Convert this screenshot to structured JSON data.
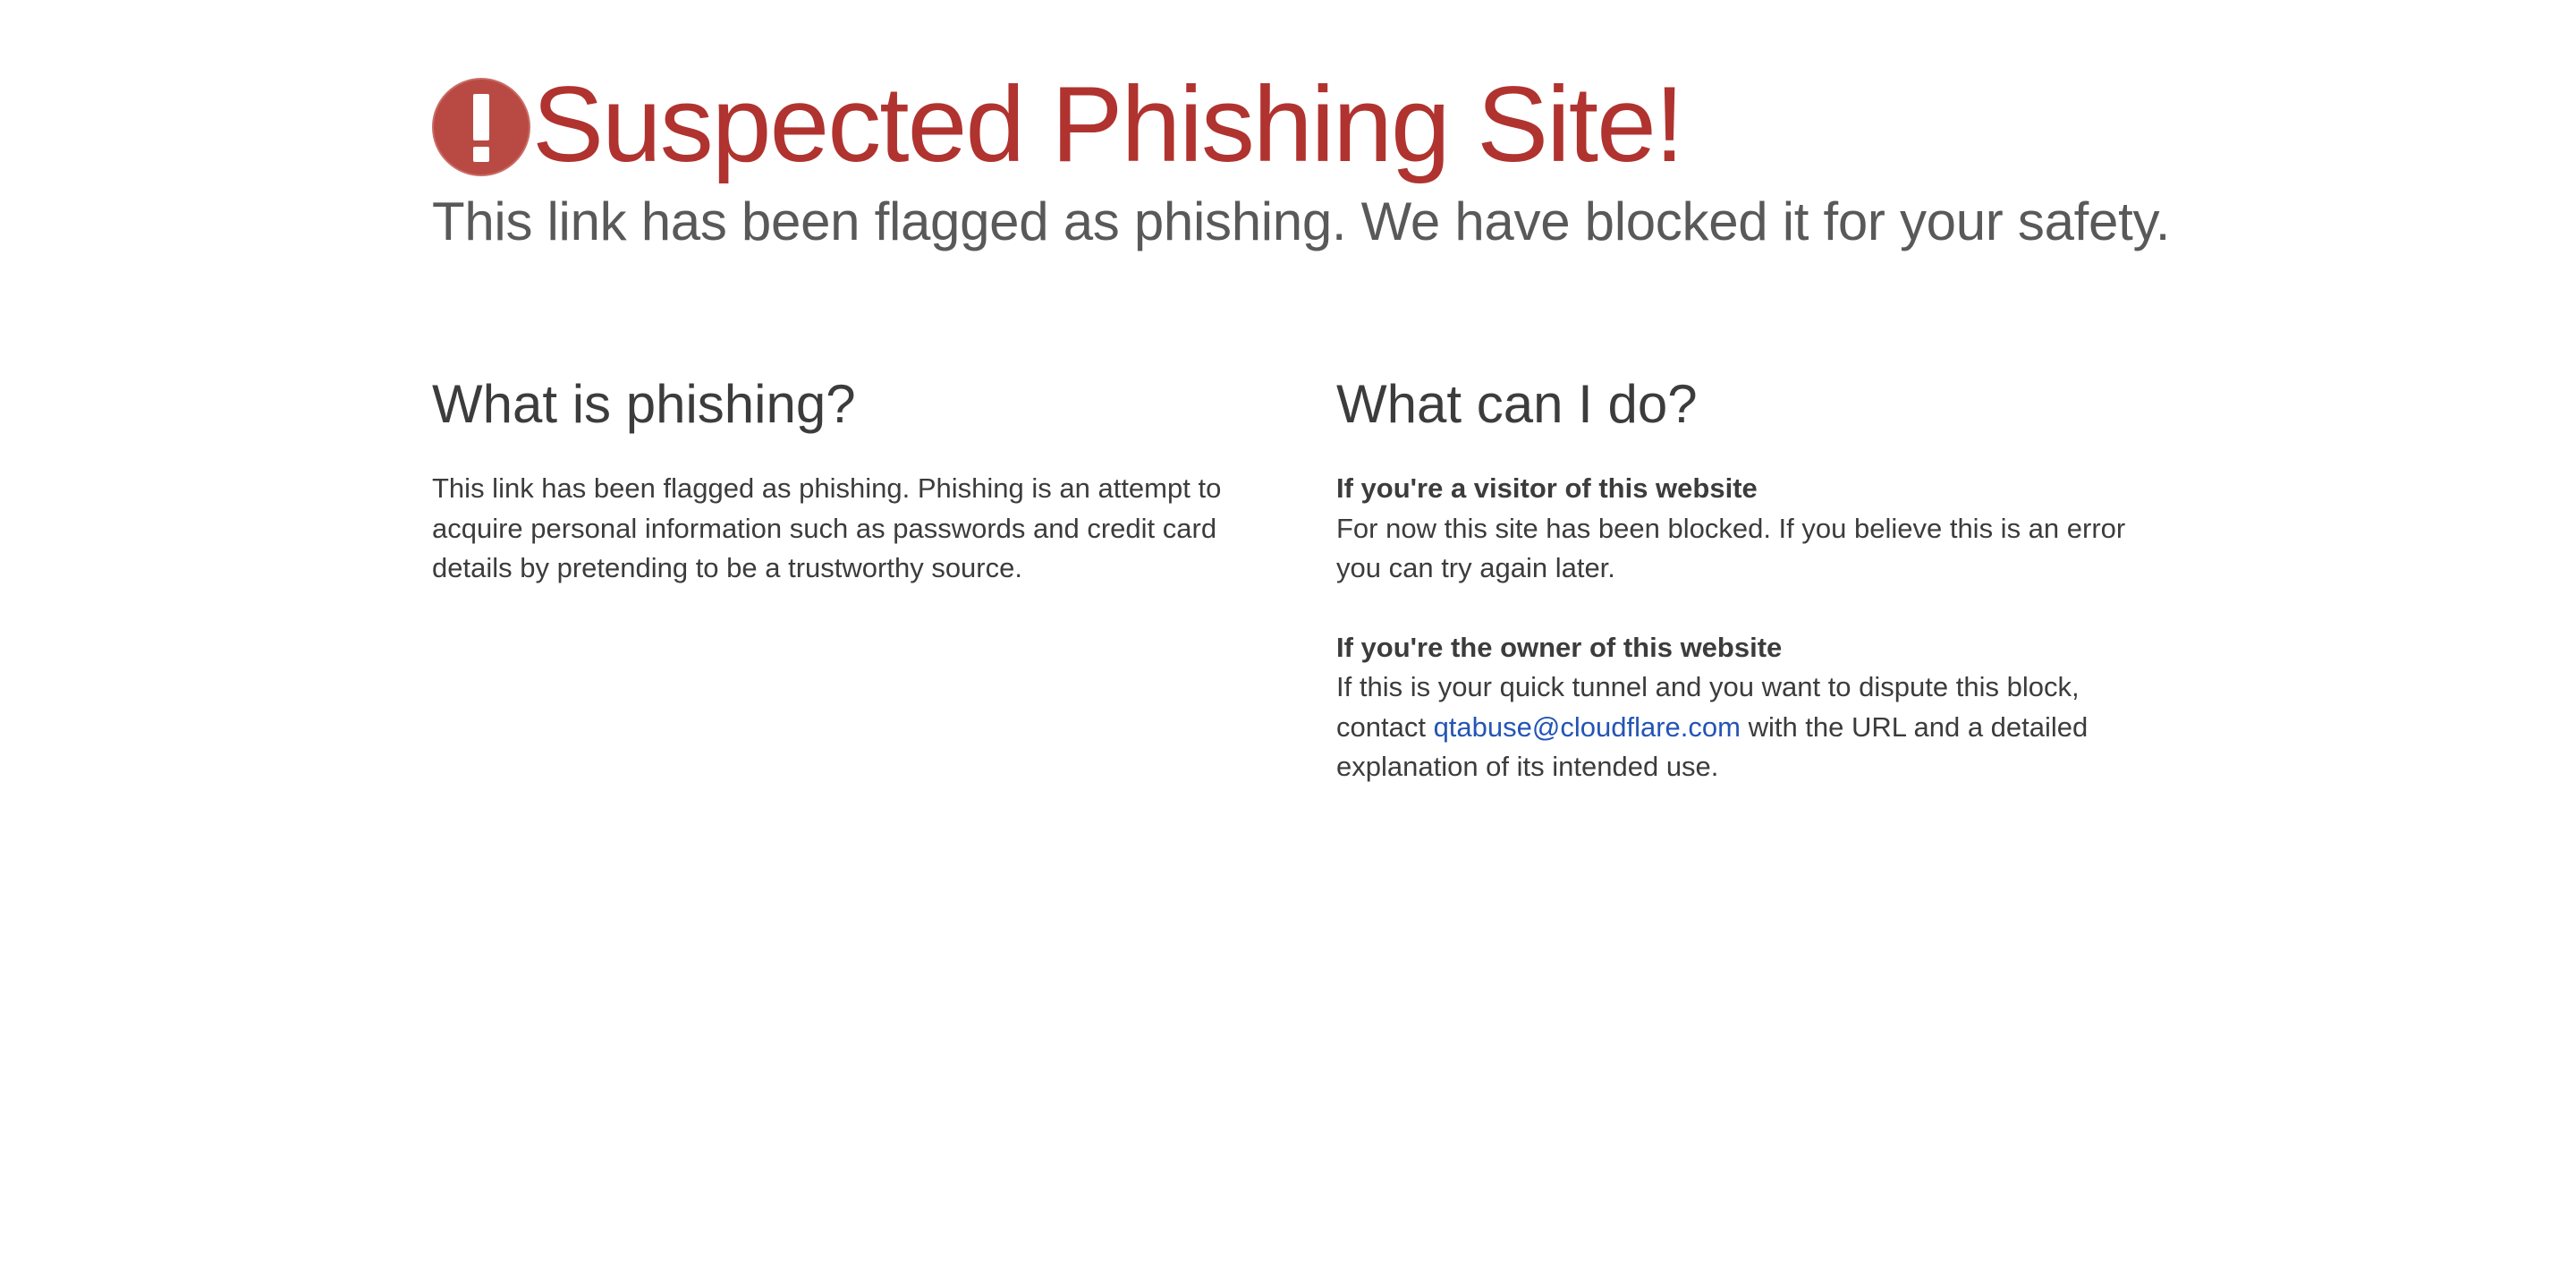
{
  "header": {
    "title": "Suspected Phishing Site!",
    "subtitle": "This link has been flagged as phishing. We have blocked it for your safety.",
    "icon": "exclamation-circle-icon",
    "title_color": "#b0332f",
    "icon_color": "#b94a43"
  },
  "left": {
    "heading": "What is phishing?",
    "body": "This link has been flagged as phishing. Phishing is an attempt to acquire personal information such as passwords and credit card details by pretending to be a trustworthy source."
  },
  "right": {
    "heading": "What can I do?",
    "visitor_title": "If you're a visitor of this website",
    "visitor_body": "For now this site has been blocked. If you believe this is an error you can try again later.",
    "owner_title": "If you're the owner of this website",
    "owner_body_before": "If this is your quick tunnel and you want to dispute this block, contact ",
    "owner_email": "qtabuse@cloudflare.com",
    "owner_body_after": " with the URL and a detailed explanation of its intended use.",
    "link_color": "#2355b5"
  }
}
